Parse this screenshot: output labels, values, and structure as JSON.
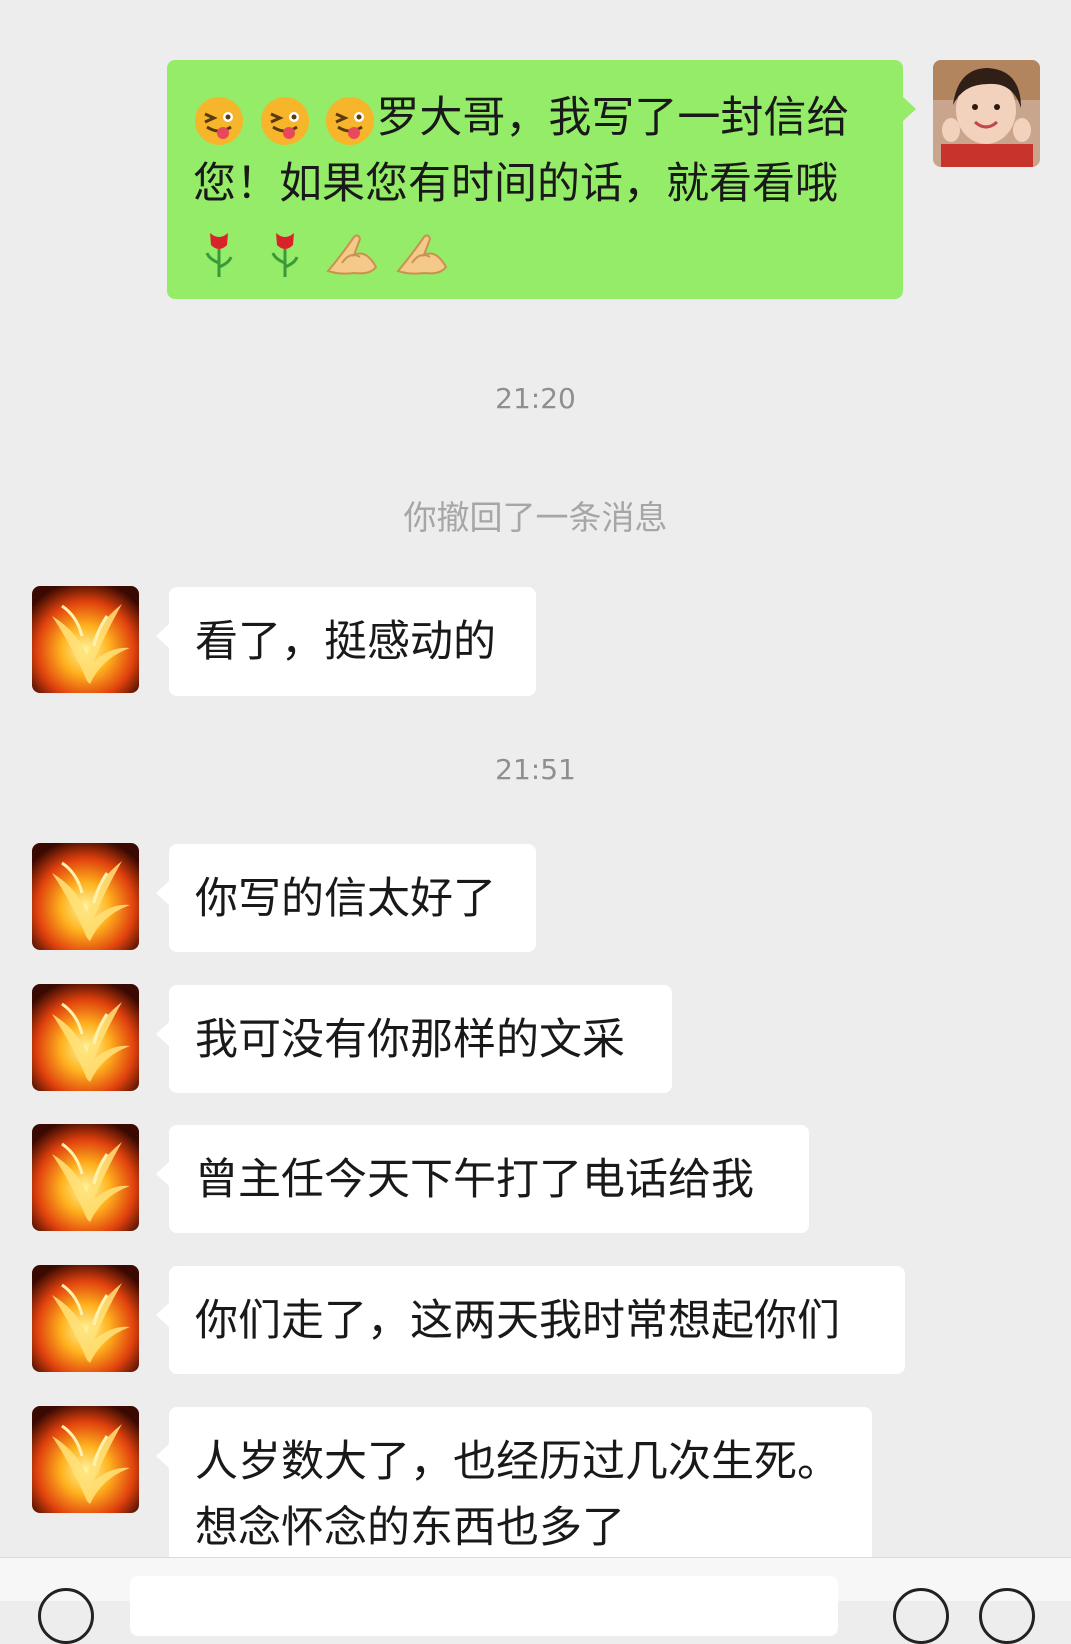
{
  "outgoing": {
    "lines": [
      "罗大哥，我写了一封信给",
      "您！如果您有时间的话，就看看哦"
    ],
    "emoji_before": [
      "squinting-tongue-emoji",
      "squinting-tongue-emoji",
      "squinting-tongue-emoji"
    ],
    "emoji_after": [
      "rose-emoji",
      "rose-emoji",
      "pinched-fingers-emoji",
      "pinched-fingers-emoji"
    ]
  },
  "timestamps": [
    "21:20",
    "21:51"
  ],
  "system_notice": "你撤回了一条消息",
  "incoming": [
    {
      "lines": [
        "看了，挺感动的"
      ]
    },
    {
      "lines": [
        "你写的信太好了"
      ]
    },
    {
      "lines": [
        "我可没有你那样的文采"
      ]
    },
    {
      "lines": [
        "曾主任今天下午打了电话给我"
      ]
    },
    {
      "lines": [
        "你们走了，这两天我时常想起你们"
      ]
    },
    {
      "lines": [
        "人岁数大了，也经历过几次生死。",
        "想念怀念的东西也多了"
      ]
    }
  ],
  "colors": {
    "background": "#ededed",
    "outgoing_bubble": "#95ec69",
    "incoming_bubble": "#ffffff",
    "timestamp_text": "#8f8f8f"
  },
  "icons": {
    "contact_avatar": "phoenix-fire-avatar",
    "self_avatar": "woman-photo-avatar",
    "bottom_left": "voice-icon",
    "bottom_right_1": "emoji-icon",
    "bottom_right_2": "plus-icon"
  }
}
